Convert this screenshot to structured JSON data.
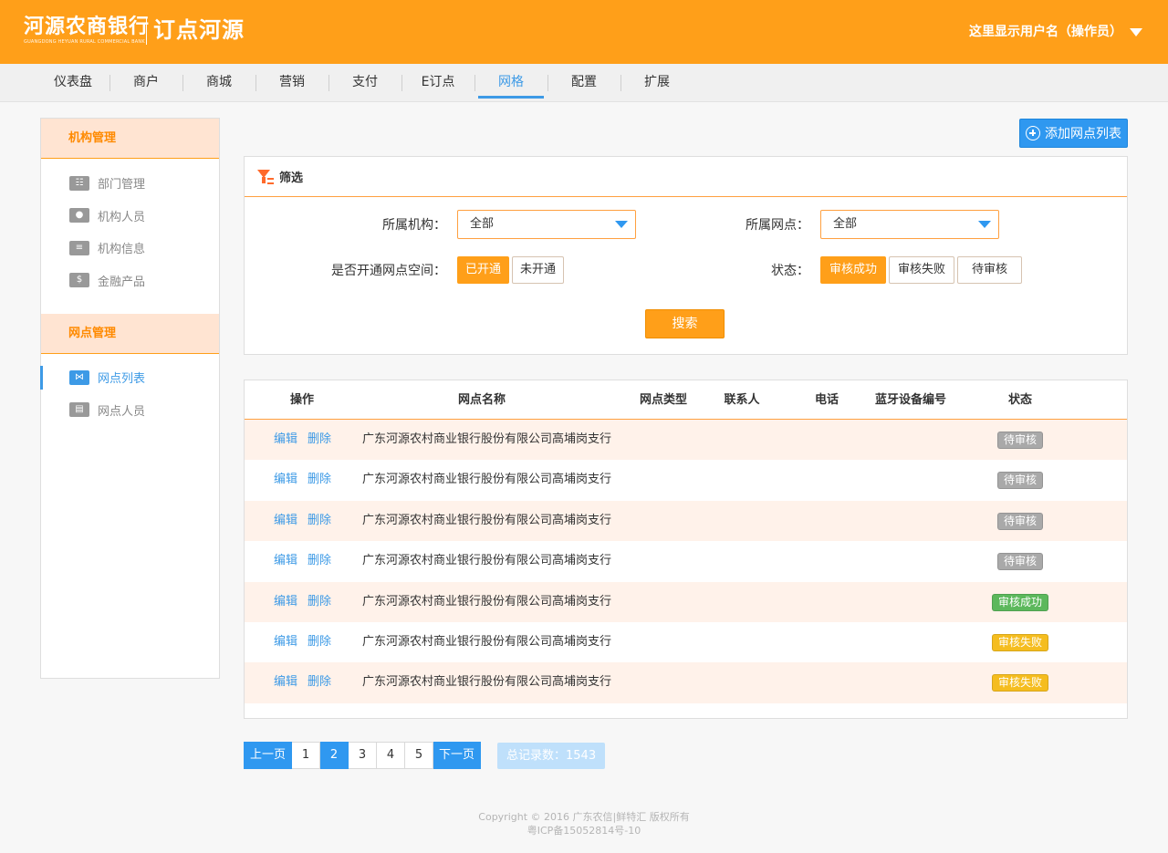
{
  "header": {
    "logo_text": "河源农商银行",
    "logo_subtext": "GUANGDONG HEYUAN RURAL COMMERCIAL BANK",
    "slogan": "订点河源",
    "user_label": "这里显示用户名（操作员）",
    "brand_color": "#ff9f19"
  },
  "nav": {
    "items": [
      "仪表盘",
      "商户",
      "商城",
      "营销",
      "支付",
      "E订点",
      "网格",
      "配置",
      "扩展"
    ],
    "active": "网格"
  },
  "sidebar": {
    "groups": [
      {
        "title": "机构管理",
        "items": [
          {
            "label": "部门管理",
            "icon": "org-chart-icon"
          },
          {
            "label": "机构人员",
            "icon": "person-icon"
          },
          {
            "label": "机构信息",
            "icon": "document-icon"
          },
          {
            "label": "金融产品",
            "icon": "money-icon"
          }
        ]
      },
      {
        "title": "网点管理",
        "items": [
          {
            "label": "网点列表",
            "icon": "network-icon",
            "active": true
          },
          {
            "label": "网点人员",
            "icon": "id-card-icon"
          }
        ]
      }
    ]
  },
  "toolbar": {
    "add_label": "添加网点列表"
  },
  "filter": {
    "title": "筛选",
    "org_label": "所属机构：",
    "org_value": "全部",
    "branch_label": "所属网点：",
    "branch_value": "全部",
    "space_label": "是否开通网点空间：",
    "space_options": [
      "已开通",
      "未开通"
    ],
    "space_selected": "已开通",
    "status_label": "状态：",
    "status_options": [
      "审核成功",
      "审核失败",
      "待审核"
    ],
    "status_selected": "审核成功",
    "search_label": "搜索"
  },
  "table": {
    "columns": [
      "操作",
      "网点名称",
      "网点类型",
      "联系人",
      "电话",
      "蓝牙设备编号",
      "状态"
    ],
    "edit_label": "编辑",
    "delete_label": "删除",
    "rows": [
      {
        "name": "广东河源农村商业银行股份有限公司高埔岗支行",
        "type": "",
        "contact": "",
        "phone": "",
        "bluetooth": "",
        "status": "待审核",
        "status_color": "#a9a9a9"
      },
      {
        "name": "广东河源农村商业银行股份有限公司高埔岗支行",
        "type": "",
        "contact": "",
        "phone": "",
        "bluetooth": "",
        "status": "待审核",
        "status_color": "#a9a9a9"
      },
      {
        "name": "广东河源农村商业银行股份有限公司高埔岗支行",
        "type": "",
        "contact": "",
        "phone": "",
        "bluetooth": "",
        "status": "待审核",
        "status_color": "#a9a9a9"
      },
      {
        "name": "广东河源农村商业银行股份有限公司高埔岗支行",
        "type": "",
        "contact": "",
        "phone": "",
        "bluetooth": "",
        "status": "待审核",
        "status_color": "#a9a9a9"
      },
      {
        "name": "广东河源农村商业银行股份有限公司高埔岗支行",
        "type": "",
        "contact": "",
        "phone": "",
        "bluetooth": "",
        "status": "审核成功",
        "status_color": "#5cb85c"
      },
      {
        "name": "广东河源农村商业银行股份有限公司高埔岗支行",
        "type": "",
        "contact": "",
        "phone": "",
        "bluetooth": "",
        "status": "审核失败",
        "status_color": "#f5bd1f"
      },
      {
        "name": "广东河源农村商业银行股份有限公司高埔岗支行",
        "type": "",
        "contact": "",
        "phone": "",
        "bluetooth": "",
        "status": "审核失败",
        "status_color": "#f5bd1f"
      }
    ]
  },
  "pagination": {
    "prev_label": "上一页",
    "next_label": "下一页",
    "pages": [
      "1",
      "2",
      "3",
      "4",
      "5"
    ],
    "current": "2",
    "total_label": "总记录数：",
    "total_value": "1543"
  },
  "footer": {
    "copyright": "Copyright © 2016 广东农信|鲜特汇 版权所有",
    "icp": "粤ICP备15052814号-10"
  }
}
